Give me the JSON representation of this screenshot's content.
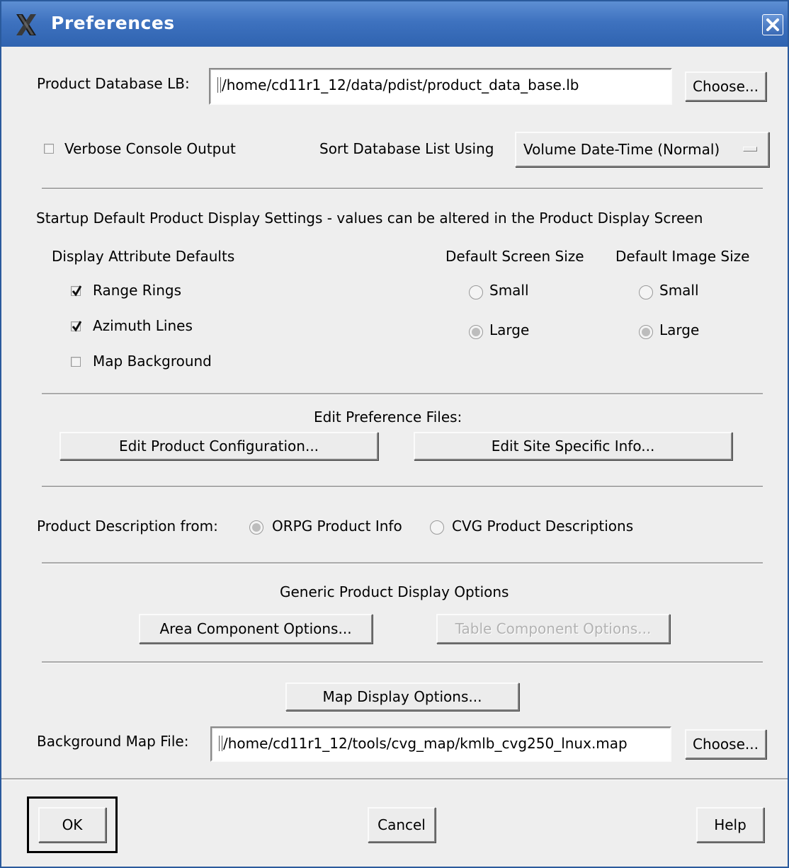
{
  "window": {
    "title": "Preferences",
    "logo_icon": "x-logo-icon",
    "close_icon": "close-icon"
  },
  "product_db": {
    "label": "Product Database LB:",
    "value": "/home/cd11r1_12/data/pdist/product_data_base.lb",
    "choose_label": "Choose..."
  },
  "verbose": {
    "label": "Verbose Console Output",
    "checked": false
  },
  "sort": {
    "label": "Sort Database List Using",
    "selected": "Volume Date-Time (Normal)"
  },
  "startup": {
    "heading": "Startup Default Product Display Settings -  values can be altered in the Product Display Screen",
    "attr_heading": "Display Attribute Defaults",
    "range_rings": {
      "label": "Range Rings",
      "checked": true
    },
    "azimuth_lines": {
      "label": "Azimuth Lines",
      "checked": true
    },
    "map_background": {
      "label": "Map Background",
      "checked": false
    },
    "screen_size": {
      "heading": "Default Screen Size",
      "small": "Small",
      "large": "Large",
      "selected": "Large"
    },
    "image_size": {
      "heading": "Default Image Size",
      "small": "Small",
      "large": "Large",
      "selected": "Large"
    }
  },
  "pref_files": {
    "heading": "Edit Preference Files:",
    "edit_product_config": "Edit Product Configuration...",
    "edit_site_info": "Edit Site Specific Info..."
  },
  "description": {
    "label": "Product Description from:",
    "orpg": "ORPG Product Info",
    "cvg": "CVG Product Descriptions",
    "selected": "ORPG Product Info"
  },
  "generic": {
    "heading": "Generic Product Display Options",
    "area_options": "Area Component Options...",
    "table_options": "Table Component Options..."
  },
  "map": {
    "display_options": "Map Display Options...",
    "file_label": "Background Map File:",
    "file_value": "/home/cd11r1_12/tools/cvg_map/kmlb_cvg250_lnux.map",
    "choose_label": "Choose..."
  },
  "footer": {
    "ok": "OK",
    "cancel": "Cancel",
    "help": "Help"
  },
  "colors": {
    "titlebar": "#3e72bf",
    "dialog_bg": "#eeeeee",
    "disabled_text": "#b2b2b2"
  }
}
